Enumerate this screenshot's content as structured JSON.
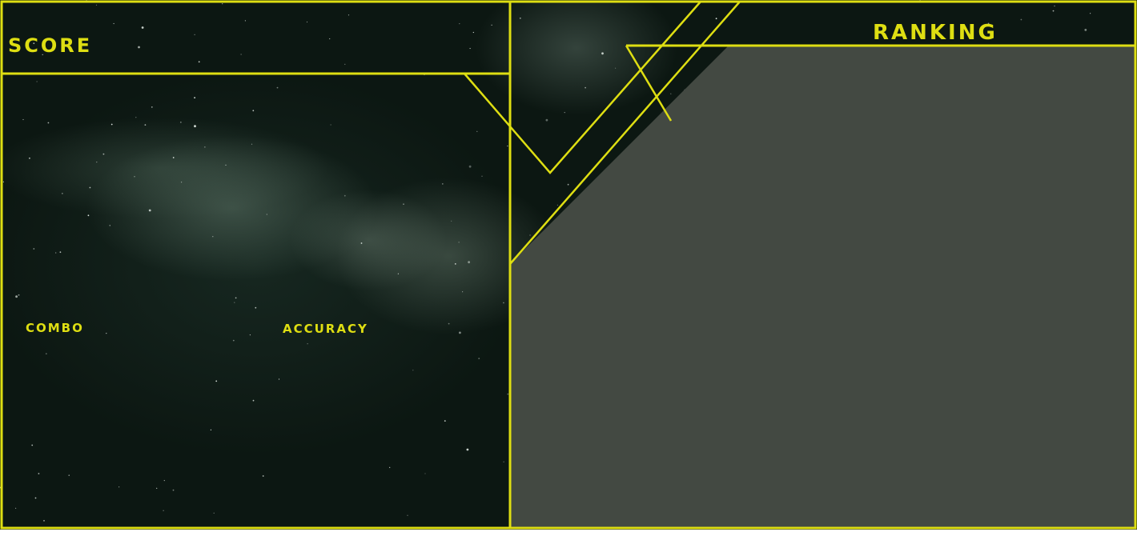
{
  "hud": {
    "score_label": "SCORE",
    "combo_label": "COMBO",
    "accuracy_label": "ACCURACY",
    "ranking_label": "RANKING"
  },
  "colors": {
    "accent": "#dede12",
    "panel": "#434942",
    "space": "#0c1712"
  }
}
